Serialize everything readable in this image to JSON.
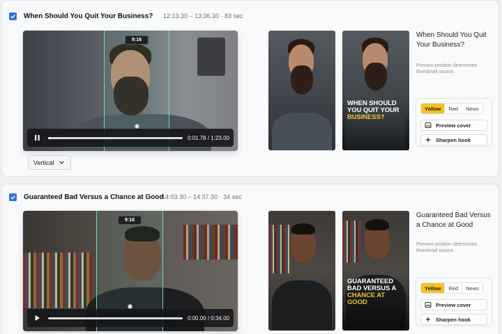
{
  "clips": [
    {
      "title": "When Should You Quit Your Business?",
      "meta": "12:13.30 – 13:36.30 · 83 sec",
      "aspect_label": "9:16",
      "time": "0:01.78 / 1:23.00",
      "progress": 0.02,
      "orientation": "Vertical",
      "cover_text_line": "WHEN SHOULD YOU QUIT YOUR",
      "cover_text_highlight": "BUSINESS?",
      "side_title": "When Should You Quit Your Business?",
      "side_note": "Preview position determines thumbnail source.",
      "styles": [
        "Yellow",
        "Red",
        "News"
      ],
      "selected_style": "Yellow",
      "preview_cover": "Preview cover",
      "sharpen_hook": "Sharpen hook"
    },
    {
      "title": "Guaranteed Bad Versus a Chance at Good",
      "meta": "14:03.30 – 14:37.30 · 34 sec",
      "aspect_label": "9:16",
      "time": "0:00.00 / 0:34.00",
      "progress": 0,
      "cover_text_line": "GUARANTEED BAD VERSUS A",
      "cover_text_highlight": "CHANCE AT GOOD",
      "side_title": "Guaranteed Bad Versus a Chance at Good",
      "side_note": "Preview position determines thumbnail source.",
      "styles": [
        "Yellow",
        "Red",
        "News"
      ],
      "selected_style": "Yellow",
      "preview_cover": "Preview cover",
      "sharpen_hook": "Sharpen hook"
    }
  ],
  "colors": {
    "accent": "#2f6fe0",
    "crop": "#6fd6c2",
    "highlight": "#f1c232",
    "style_selected": "#f6c21c"
  },
  "icons": [
    "checkbox-checked-icon",
    "pause-icon",
    "play-icon",
    "chevron-down-icon",
    "image-icon",
    "sparkle-icon"
  ]
}
